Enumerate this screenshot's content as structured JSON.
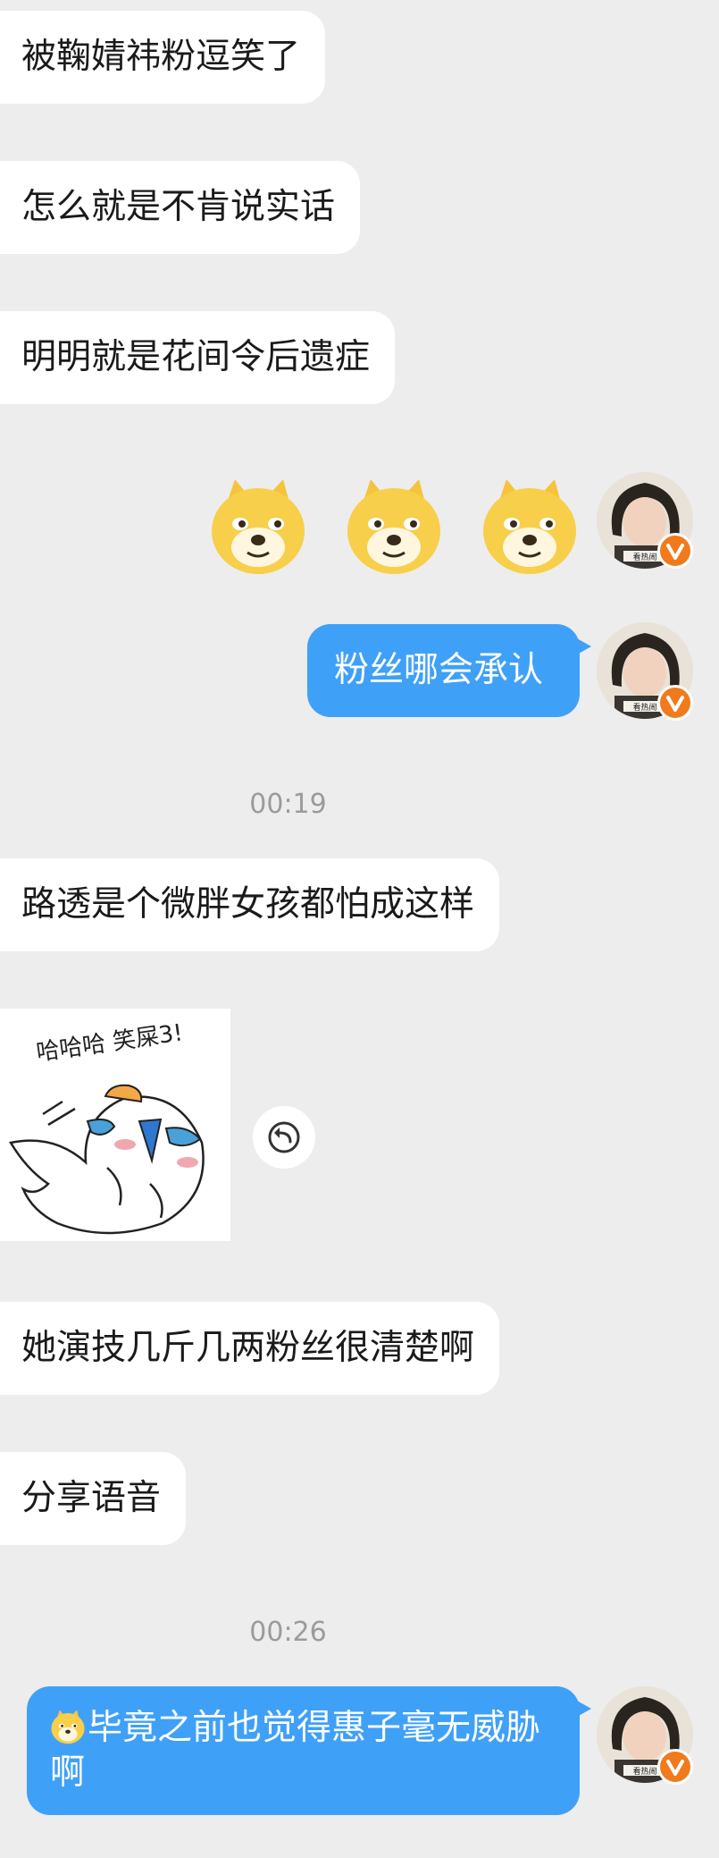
{
  "messages": {
    "m1": "被鞠婧祎粉逗笑了",
    "m2": "怎么就是不肯说实话",
    "m3": "明明就是花间令后遗症",
    "m4": "粉丝哪会承认",
    "m5": "路透是个微胖女孩都怕成这样",
    "m6": "她演技几斤几两粉丝很清楚啊",
    "m7": "分享语音",
    "m8": "毕竟之前也觉得惠子毫无威胁啊"
  },
  "timestamps": {
    "t1": "00:19",
    "t2": "00:26"
  },
  "sticker": {
    "caption": "哈哈哈 笑屎3!"
  },
  "avatar": {
    "label": "看热闹"
  },
  "colors": {
    "background": "#ededed",
    "incoming_bubble": "#ffffff",
    "outgoing_bubble": "#3fa0f8",
    "verified_badge": "#f07a1c"
  },
  "icons": [
    "doge-emoji-icon",
    "resend-icon",
    "verified-badge-icon",
    "avatar"
  ]
}
